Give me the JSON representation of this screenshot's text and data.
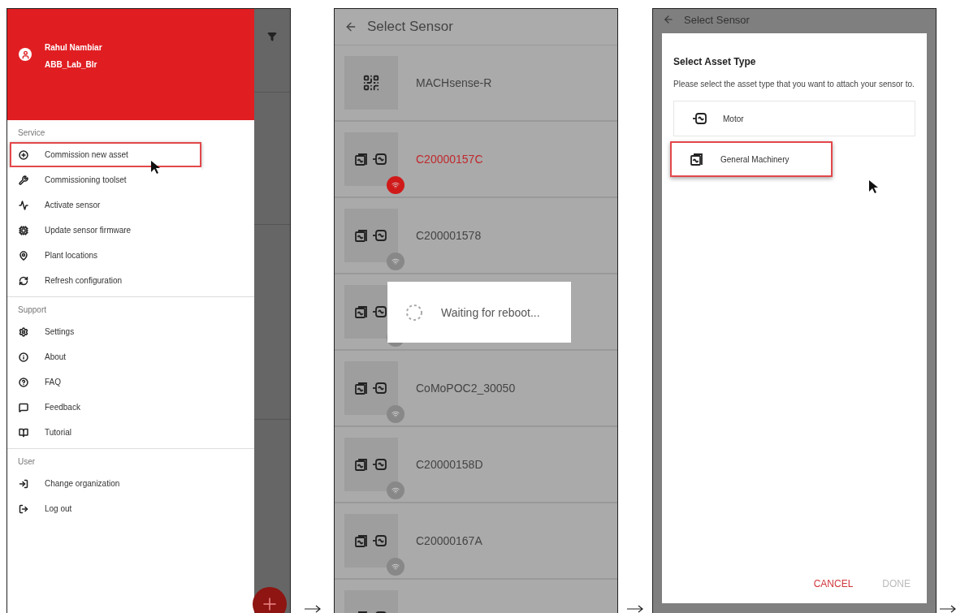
{
  "drawer": {
    "user_name": "Rahul Nambiar",
    "organization": "ABB_Lab_Blr",
    "sections": [
      {
        "label": "Service",
        "items": [
          {
            "label": "Commission new asset",
            "highlighted": true
          },
          {
            "label": "Commissioning toolset",
            "highlighted": false
          },
          {
            "label": "Activate sensor",
            "highlighted": false
          },
          {
            "label": "Update sensor firmware",
            "highlighted": false
          },
          {
            "label": "Plant locations",
            "highlighted": false
          },
          {
            "label": "Refresh configuration",
            "highlighted": false
          }
        ]
      },
      {
        "label": "Support",
        "items": [
          {
            "label": "Settings",
            "highlighted": false
          },
          {
            "label": "About",
            "highlighted": false
          },
          {
            "label": "FAQ",
            "highlighted": false
          },
          {
            "label": "Feedback",
            "highlighted": false
          },
          {
            "label": "Tutorial",
            "highlighted": false
          }
        ]
      },
      {
        "label": "User",
        "items": [
          {
            "label": "Change organization",
            "highlighted": false
          },
          {
            "label": "Log out",
            "highlighted": false
          }
        ]
      }
    ]
  },
  "sensor_screen": {
    "title": "Select Sensor",
    "sensors": [
      {
        "kind": "qr",
        "name": "MACHsense-R"
      },
      {
        "kind": "sensor",
        "name": "C20000157C",
        "alert": true
      },
      {
        "kind": "sensor",
        "name": "C200001578",
        "alert": false
      },
      {
        "kind": "sensor",
        "alert": false
      },
      {
        "kind": "sensor",
        "name": "CoMoPOC2_30050",
        "alert": false
      },
      {
        "kind": "sensor",
        "name": "C20000158D",
        "alert": false
      },
      {
        "kind": "sensor",
        "name": "C20000167A",
        "alert": false
      },
      {
        "kind": "sensor"
      }
    ],
    "progress_dialog": {
      "message": "Waiting for reboot..."
    }
  },
  "asset_screen": {
    "title": "Select Sensor",
    "dialog": {
      "title": "Select Asset Type",
      "description": "Please select the asset type that you want to attach your sensor to.",
      "options": [
        {
          "kind": "motor",
          "label": "Motor",
          "highlighted": false
        },
        {
          "kind": "machinery",
          "label": "General Machinery",
          "highlighted": true
        }
      ],
      "buttons": [
        {
          "label": "CANCEL",
          "disabled": false
        },
        {
          "label": "DONE",
          "disabled": true
        }
      ]
    }
  }
}
